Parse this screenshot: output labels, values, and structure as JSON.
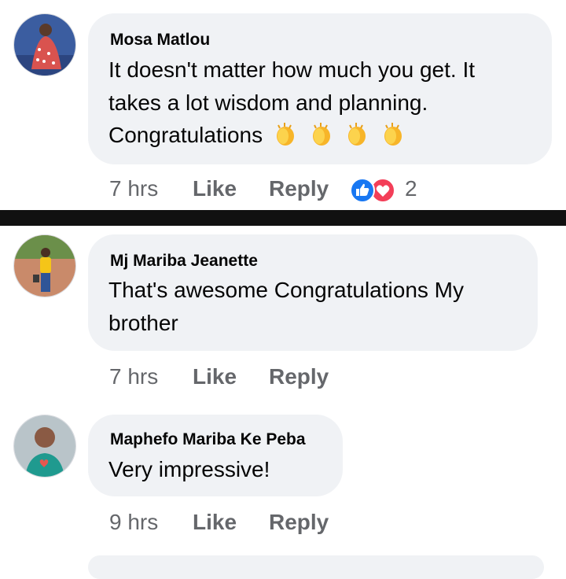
{
  "comments": [
    {
      "author": "Mosa Matlou",
      "text_lines": [
        "It doesn't matter how much you get. It",
        "takes a lot wisdom and planning."
      ],
      "text_last": "Congratulations",
      "time": "7 hrs",
      "like_label": "Like",
      "reply_label": "Reply",
      "reaction_count": "2",
      "reactions": [
        "like-icon",
        "love-icon"
      ],
      "emoji": [
        "clapping-hands-icon",
        "clapping-hands-icon",
        "clapping-hands-icon",
        "clapping-hands-icon"
      ]
    },
    {
      "author": "Mj Mariba Jeanette",
      "text_lines": [
        "That's awesome Congratulations My",
        "brother"
      ],
      "time": "7 hrs",
      "like_label": "Like",
      "reply_label": "Reply"
    },
    {
      "author": "Maphefo Mariba Ke Peba",
      "text_lines": [
        "Very impressive!"
      ],
      "time": "9 hrs",
      "like_label": "Like",
      "reply_label": "Reply"
    }
  ],
  "colors": {
    "bubble": "#f0f2f5",
    "meta_text": "#65676b",
    "like_blue": "#1877f2",
    "love_red": "#f33e58",
    "divider": "#111111"
  }
}
